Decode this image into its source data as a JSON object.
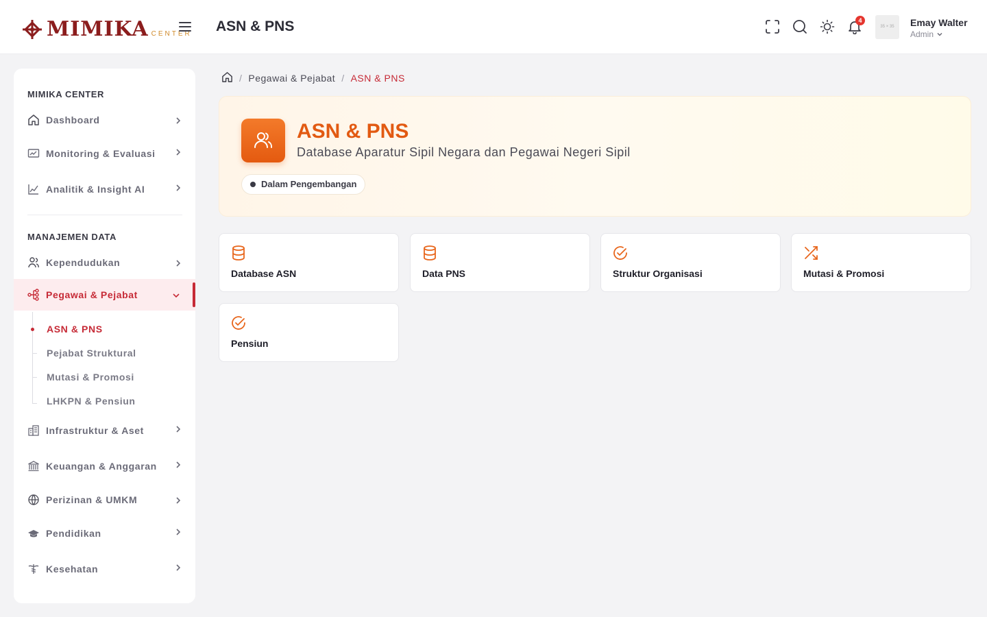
{
  "header": {
    "logo_text": "MIMIKA",
    "logo_sub": "CENTER",
    "title": "ASN & PNS",
    "notification_count": "4",
    "avatar_placeholder": "35 × 35",
    "user_name": "Emay Walter",
    "user_role": "Admin"
  },
  "sidebar": {
    "section1": "MIMIKA CENTER",
    "section2": "MANAJEMEN DATA",
    "items": [
      {
        "label": "Dashboard",
        "icon": "home-icon"
      },
      {
        "label": "Monitoring & Evaluasi",
        "icon": "monitor-icon"
      },
      {
        "label": "Analitik & Insight AI",
        "icon": "chart-icon"
      },
      {
        "label": "Kependudukan",
        "icon": "users-icon"
      },
      {
        "label": "Pegawai & Pejabat",
        "icon": "org-icon"
      },
      {
        "label": "Infrastruktur & Aset",
        "icon": "building-icon"
      },
      {
        "label": "Keuangan & Anggaran",
        "icon": "bank-icon"
      },
      {
        "label": "Perizinan & UMKM",
        "icon": "globe-icon"
      },
      {
        "label": "Pendidikan",
        "icon": "graduation-icon"
      },
      {
        "label": "Kesehatan",
        "icon": "caduceus-icon"
      }
    ],
    "subitems": [
      "ASN & PNS",
      "Pejabat Struktural",
      "Mutasi & Promosi",
      "LHKPN & Pensiun"
    ]
  },
  "breadcrumb": {
    "parent": "Pegawai & Pejabat",
    "current": "ASN & PNS"
  },
  "hero": {
    "title": "ASN & PNS",
    "subtitle": "Database Aparatur Sipil Negara dan Pegawai Negeri Sipil",
    "status": "Dalam Pengembangan"
  },
  "cards": [
    {
      "label": "Database ASN",
      "icon": "database-icon"
    },
    {
      "label": "Data PNS",
      "icon": "database-icon"
    },
    {
      "label": "Struktur Organisasi",
      "icon": "check-circle-icon"
    },
    {
      "label": "Mutasi & Promosi",
      "icon": "shuffle-icon"
    },
    {
      "label": "Pensiun",
      "icon": "check-circle-icon"
    }
  ],
  "colors": {
    "brand": "#8b1d1d",
    "accent": "#e25a12",
    "active": "#c62a36"
  }
}
